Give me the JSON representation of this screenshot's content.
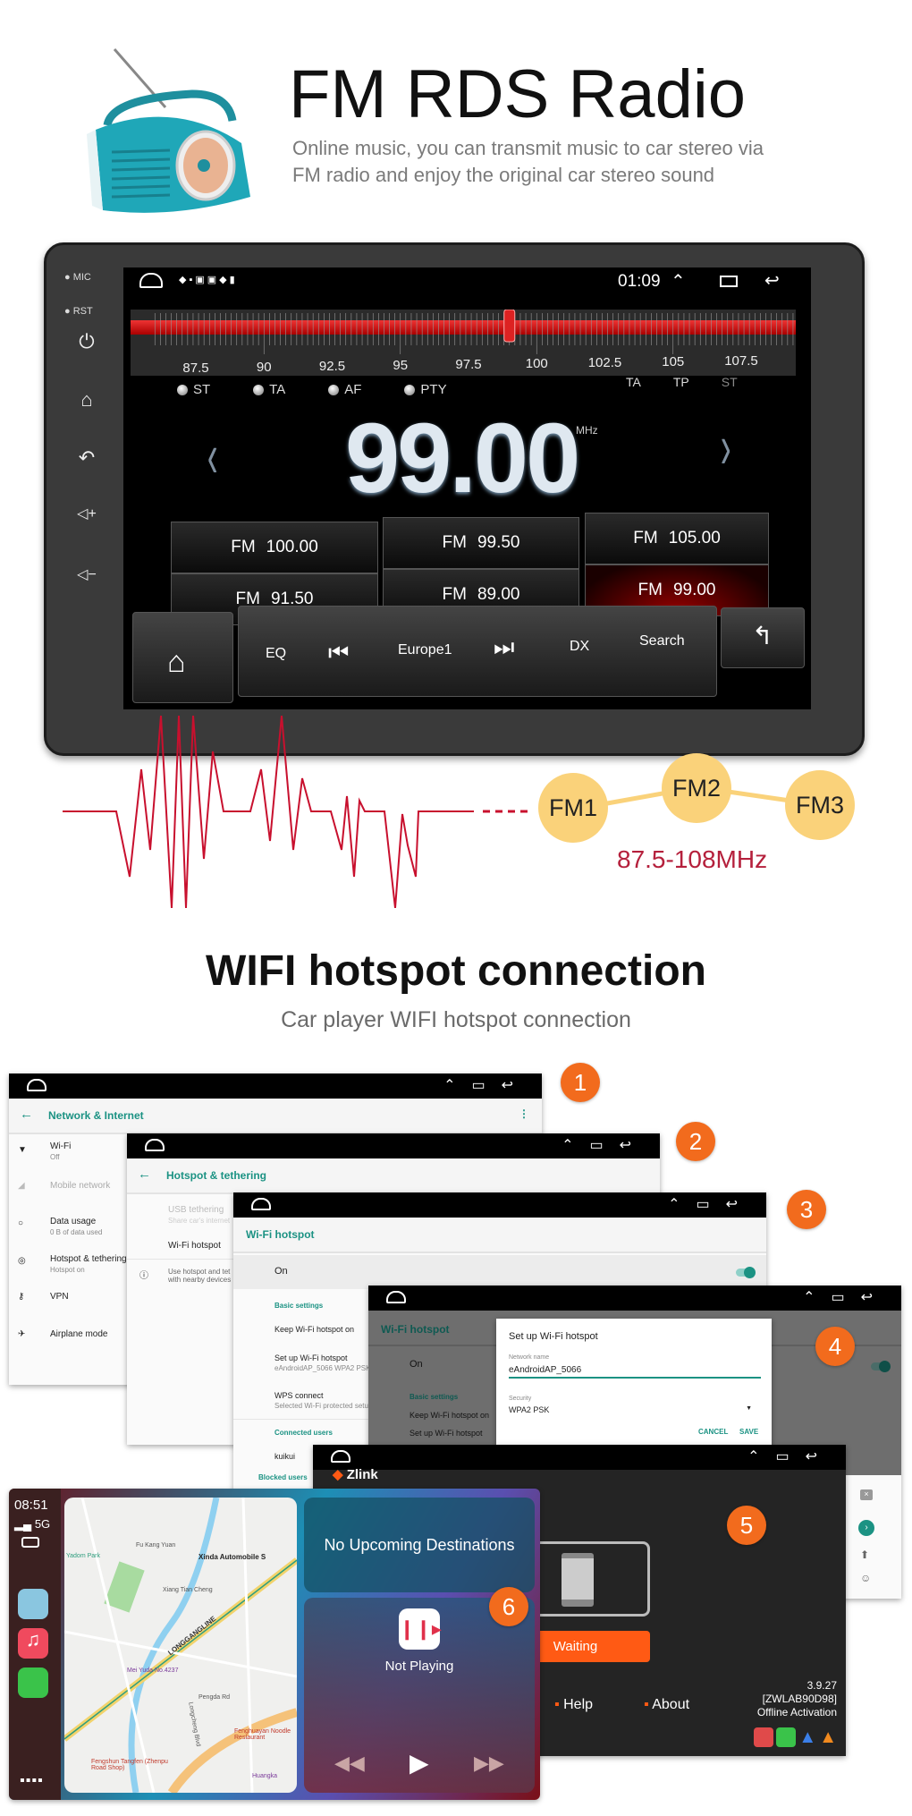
{
  "radio_section": {
    "title": "FM RDS Radio",
    "subtitle_lines": [
      "Online music, you can transmit music to car stereo via",
      "FM radio and enjoy the original car stereo sound"
    ],
    "head_unit": {
      "side_labels": {
        "mic": "MIC",
        "rst": "RST"
      },
      "status_time": "01:09",
      "dial_labels": [
        "87.5",
        "90",
        "92.5",
        "95",
        "97.5",
        "100",
        "102.5",
        "105",
        "107.5"
      ],
      "dial_value_mhz": 99.0,
      "indicators": [
        "ST",
        "TA",
        "AF",
        "PTY"
      ],
      "flags": [
        "TA",
        "TP",
        "ST"
      ],
      "frequency": "99.00",
      "frequency_unit": "MHz",
      "presets": [
        {
          "band": "FM",
          "freq": "100.00",
          "active": false
        },
        {
          "band": "FM",
          "freq": "99.50",
          "active": false
        },
        {
          "band": "FM",
          "freq": "105.00",
          "active": false
        },
        {
          "band": "FM",
          "freq": "91.50",
          "active": false
        },
        {
          "band": "FM",
          "freq": "89.00",
          "active": false
        },
        {
          "band": "FM",
          "freq": "99.00",
          "active": true
        }
      ],
      "controls": {
        "eq": "EQ",
        "station": "Europe1",
        "dx": "DX",
        "search": "Search"
      }
    },
    "bands": [
      "FM1",
      "FM2",
      "FM3"
    ],
    "range": "87.5-108MHz",
    "colors": {
      "accent_red": "#b5203c",
      "band_circle": "#fad27a"
    }
  },
  "wifi_section": {
    "title": "WIFI hotspot connection",
    "subtitle": "Car player WIFI hotspot connection",
    "steps": [
      "1",
      "2",
      "3",
      "4",
      "5",
      "6"
    ],
    "screen1": {
      "title": "Network & Internet",
      "items": [
        {
          "label": "Wi-Fi",
          "sub": "Off"
        },
        {
          "label": "Mobile network",
          "sub": ""
        },
        {
          "label": "Data usage",
          "sub": "0 B of data used"
        },
        {
          "label": "Hotspot & tethering",
          "sub": "Hotspot on"
        },
        {
          "label": "VPN",
          "sub": ""
        },
        {
          "label": "Airplane mode",
          "sub": ""
        }
      ]
    },
    "screen2": {
      "title": "Hotspot & tethering",
      "usb": "USB tethering",
      "usb_sub": "Share car's internet",
      "wifi_hotspot": "Wi-Fi hotspot",
      "info1": "Use hotspot and tet",
      "info2": "with nearby devices"
    },
    "screen3": {
      "title": "Wi-Fi hotspot",
      "on": "On",
      "basic": "Basic settings",
      "keep": "Keep Wi-Fi hotspot on",
      "setup": "Set up Wi-Fi hotspot",
      "setup_sub": "eAndroidAP_5066 WPA2 PSK",
      "wps": "WPS connect",
      "wps_sub": "Selected Wi-Fi protected setup",
      "connected": "Connected users",
      "user": "kuikui",
      "blocked": "Blocked users"
    },
    "screen4": {
      "title": "Wi-Fi hotspot",
      "on": "On",
      "basic": "Basic settings",
      "keep": "Keep Wi-Fi hotspot on",
      "setup": "Set up Wi-Fi hotspot",
      "dialog": {
        "title": "Set up Wi-Fi hotspot",
        "name_label": "Network name",
        "name_value": "eAndroidAP_5066",
        "security_label": "Security",
        "security_value": "WPA2 PSK",
        "cancel": "CANCEL",
        "save": "SAVE"
      }
    },
    "screen5": {
      "brand": "Zlink",
      "waiting": "Waiting",
      "help": "Help",
      "about": "About",
      "version": "3.9.27",
      "code": "[ZWLAB90D98]",
      "activation": "Offline Activation",
      "accent": "#ff5a14"
    },
    "screen6": {
      "time": "08:51",
      "signal": "5G",
      "destinations": "No Upcoming Destinations",
      "now_playing": "Not Playing",
      "map_labels": {
        "poi": "Xinda Automobile S",
        "line": "LONGGANGLINE",
        "shop": "Mei Yuda No.4237",
        "restaurant1": "Fengshun Tangfen (Zhenpu Road Shop)",
        "restaurant2": "Fenghuayan Noodle Restaurant",
        "place": "Huangka",
        "road1": "Pengda Rd",
        "road2": "Longcheng Blvd",
        "park": "Yadom Park",
        "road3": "Xiang Tian Cheng",
        "road4": "Fu Kang Yuan"
      }
    }
  }
}
